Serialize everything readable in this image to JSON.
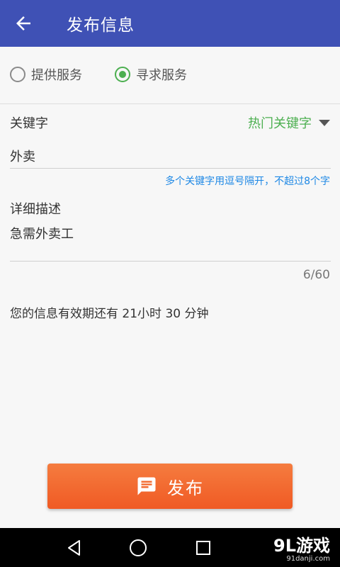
{
  "header": {
    "title": "发布信息",
    "back_icon": "arrow-left-icon",
    "bg_color": "#3f51b5"
  },
  "service_type": {
    "options": [
      {
        "label": "提供服务",
        "selected": false
      },
      {
        "label": "寻求服务",
        "selected": true
      }
    ],
    "accent_color": "#4caf50"
  },
  "keywords": {
    "label": "关键字",
    "hot_label": "热门关键字",
    "value": "外卖",
    "hint": "多个关键字用逗号隔开，不超过8个字"
  },
  "description": {
    "label": "详细描述",
    "value": "急需外卖工",
    "counter": "6/60"
  },
  "validity_text": "您的信息有效期还有 21小时 30 分钟",
  "publish_button": {
    "label": "发布",
    "icon": "message-icon",
    "color": "#f05a24"
  },
  "system_nav": {
    "back_icon": "nav-back-icon",
    "home_icon": "nav-home-icon",
    "recent_icon": "nav-recent-icon"
  },
  "watermark": {
    "main": "9L游戏",
    "sub": "91danji.com"
  }
}
